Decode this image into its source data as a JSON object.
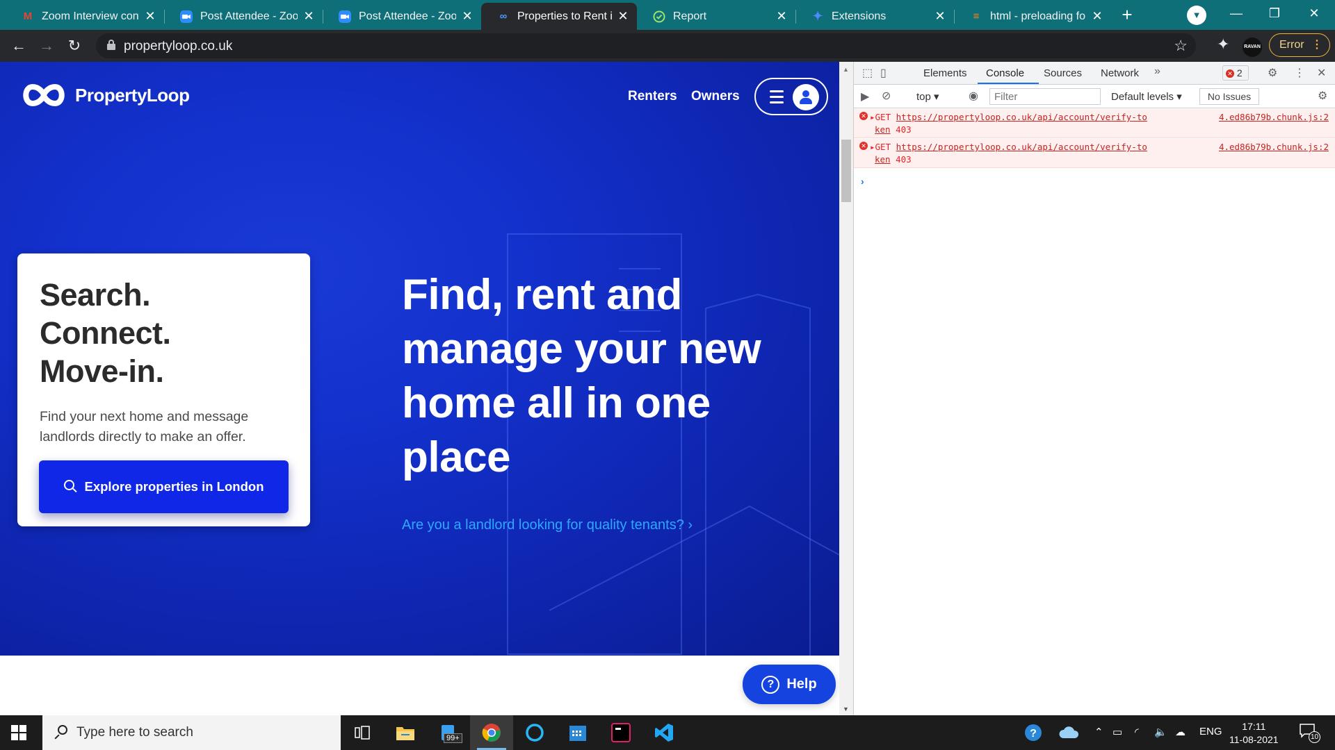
{
  "browser": {
    "tabs": [
      {
        "title": "Zoom Interview confirm",
        "icon": "gmail-icon"
      },
      {
        "title": "Post Attendee - Zoom",
        "icon": "zoom-icon"
      },
      {
        "title": "Post Attendee - Zoom",
        "icon": "zoom-icon"
      },
      {
        "title": "Properties to Rent in London",
        "icon": "propertyloop-icon",
        "active": true
      },
      {
        "title": "Report",
        "icon": "check-circle-icon"
      },
      {
        "title": "Extensions",
        "icon": "puzzle-icon"
      },
      {
        "title": "html - preloading font",
        "icon": "stackoverflow-icon"
      }
    ],
    "url": "propertyloop.co.uk",
    "profile_chip": "RAVAN",
    "error_chip": "Error"
  },
  "site": {
    "brand": "PropertyLoop",
    "nav": {
      "renters": "Renters",
      "owners": "Owners"
    },
    "card": {
      "line1": "Search.",
      "line2": "Connect.",
      "line3": "Move-in.",
      "body": "Find your next home and message landlords directly to make an offer.",
      "button": "Explore properties in London"
    },
    "hero": {
      "line1": "Find, rent and",
      "line2": "manage your new",
      "line3": "home all in one",
      "line4": "place",
      "landlord_link": "Are you a landlord looking for quality tenants?"
    },
    "help": "Help",
    "colors": {
      "hero_blue": "#1331cc",
      "button_blue": "#1127e8",
      "link_blue": "#2ea8ff"
    }
  },
  "devtools": {
    "tabs": [
      "Elements",
      "Console",
      "Sources",
      "Network"
    ],
    "active_tab": "Console",
    "error_count": "2",
    "context": "top",
    "filter_placeholder": "Filter",
    "levels": "Default levels",
    "issues": "No Issues",
    "messages": [
      {
        "method": "GET",
        "url_line1": "https://propertyloop.co.uk/api/account/verify-to",
        "url_line2": "ken",
        "status": "403",
        "source": "4.ed86b79b.chunk.js:2"
      },
      {
        "method": "GET",
        "url_line1": "https://propertyloop.co.uk/api/account/verify-to",
        "url_line2": "ken",
        "status": "403",
        "source": "4.ed86b79b.chunk.js:2"
      }
    ]
  },
  "taskbar": {
    "search_placeholder": "Type here to search",
    "mail_badge": "99+",
    "language": "ENG",
    "time": "17:11",
    "date": "11-08-2021",
    "notification_count": "10"
  }
}
